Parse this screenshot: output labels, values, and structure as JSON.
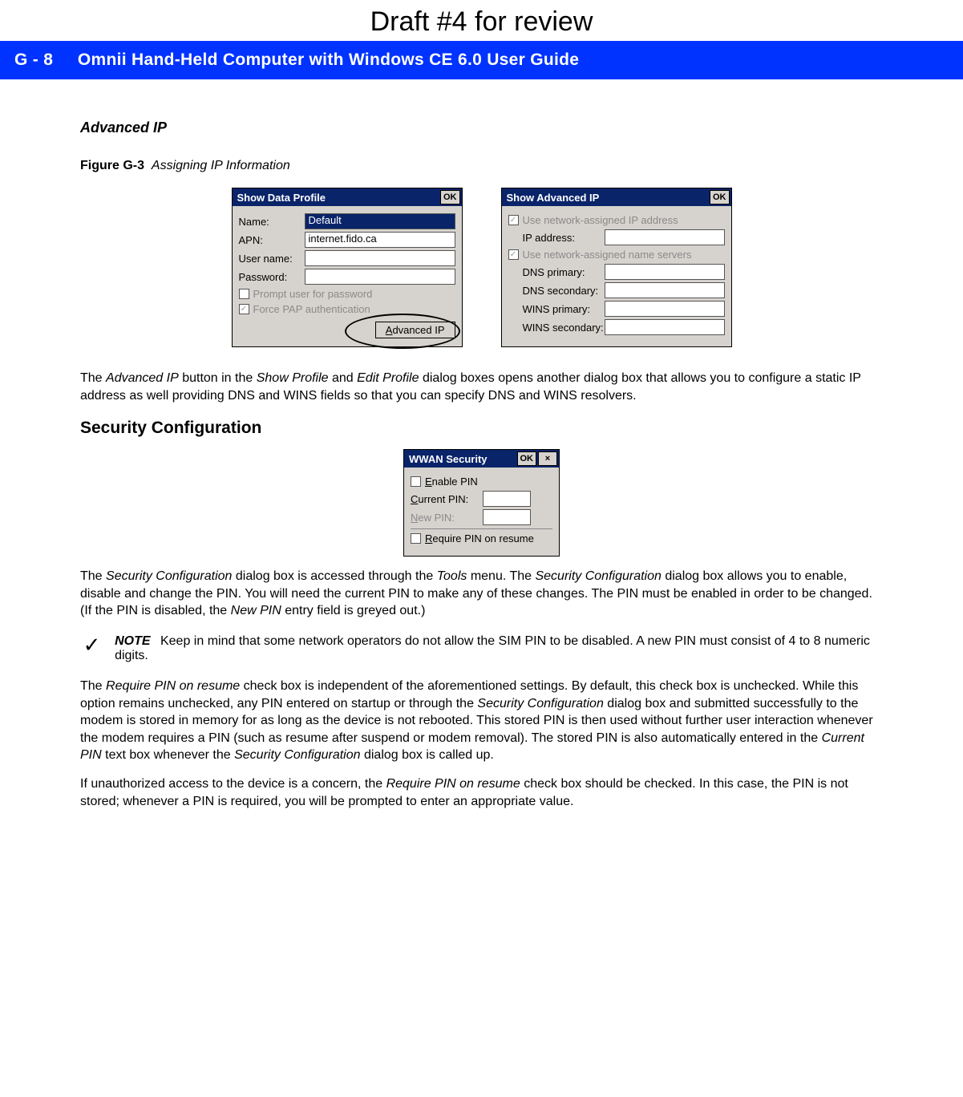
{
  "draft_banner": "Draft #4 for review",
  "header": {
    "page_ref": "G - 8",
    "title": "Omnii Hand-Held Computer with Windows CE 6.0 User Guide"
  },
  "advanced_ip_heading": "Advanced IP",
  "figure": {
    "number": "Figure G-3",
    "caption": "Assigning IP Information"
  },
  "dialog1": {
    "title": "Show Data Profile",
    "ok": "OK",
    "name_label": "Name:",
    "name_value": "Default",
    "apn_label": "APN:",
    "apn_value": "internet.fido.ca",
    "user_label": "User name:",
    "user_value": "",
    "pass_label": "Password:",
    "pass_value": "",
    "prompt_label": "Prompt user for password",
    "force_label": "Force PAP authentication",
    "adv_btn_prefix": "A",
    "adv_btn_rest": "dvanced IP"
  },
  "dialog2": {
    "title": "Show Advanced IP",
    "ok": "OK",
    "use_ip_label": "Use network-assigned IP address",
    "ip_label": "IP address:",
    "use_ns_label": "Use network-assigned name servers",
    "dns_p_label": "DNS primary:",
    "dns_s_label": "DNS secondary:",
    "wins_p_label": "WINS primary:",
    "wins_s_label": "WINS secondary:"
  },
  "para1_a": "The ",
  "para1_b": "Advanced IP",
  "para1_c": " button in the ",
  "para1_d": "Show Profile",
  "para1_e": " and ",
  "para1_f": "Edit Profile",
  "para1_g": " dialog boxes opens another dialog box that allows you to configure a static IP address as well providing DNS and WINS fields so that you can specify DNS and WINS resolvers.",
  "security_heading": "Security Configuration",
  "dialog3": {
    "title": "WWAN Security",
    "ok": "OK",
    "close": "×",
    "enable_u": "E",
    "enable_rest": "nable PIN",
    "current_u": "C",
    "current_rest": "urrent PIN:",
    "new_u": "N",
    "new_rest": "ew PIN:",
    "require_u": "R",
    "require_rest": "equire PIN on resume"
  },
  "para2_a": "The ",
  "para2_b": "Security Configuration",
  "para2_c": " dialog box is accessed through the ",
  "para2_d": "Tools",
  "para2_e": " menu. The ",
  "para2_f": "Security Configuration",
  "para2_g": " dialog box allows you to enable, disable and change the PIN. You will need the current PIN to make any of these changes. The PIN must be enabled in order to be changed. (If the PIN is disabled, the ",
  "para2_h": "New PIN",
  "para2_i": " entry field is greyed out.)",
  "note_label": "NOTE",
  "note_text": "Keep in mind that some network operators do not allow the SIM PIN to be disabled. A new PIN must consist of 4 to 8 numeric digits.",
  "para3_a": "The ",
  "para3_b": "Require PIN on resume",
  "para3_c": " check box is independent of the aforementioned settings. By default, this check box is unchecked. While this option remains unchecked, any PIN entered on startup or through the ",
  "para3_d": "Security Configuration",
  "para3_e": " dialog box and submitted successfully to the modem is stored in memory for as long as the device is not rebooted. This stored PIN is then used without further user interaction whenever the modem requires a PIN (such as resume after suspend or modem removal). The stored PIN is also automatically entered in the ",
  "para3_f": "Current PIN",
  "para3_g": " text box whenever the ",
  "para3_h": "Security Configuration",
  "para3_i": " dialog box is called up.",
  "para4_a": "If unauthorized access to the device is a concern, the ",
  "para4_b": "Require PIN on resume",
  "para4_c": " check box should be checked. In this case, the PIN is not stored; whenever a PIN is required, you will be prompted to enter an appropriate value."
}
